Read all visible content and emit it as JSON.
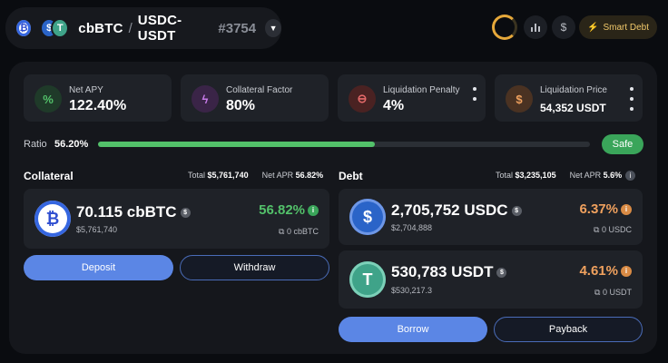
{
  "header": {
    "tokens": [
      {
        "icon": "bitcoin-icon",
        "glyph": "₿"
      },
      {
        "icon": "usdc-icon",
        "glyph": "$"
      },
      {
        "icon": "usdt-icon",
        "glyph": "T"
      }
    ],
    "asset": "cbBTC",
    "slash": "/",
    "pair": "USDC-USDT",
    "id": "#3754",
    "dropdown_glyph": "▼"
  },
  "controls": {
    "chart_glyph": "📊",
    "dollar_glyph": "$",
    "smart_debt_glyph": "⚡",
    "smart_debt_label": "Smart Debt"
  },
  "stats": [
    {
      "label": "Net APY",
      "value": "122.40%",
      "icon": "percent-icon",
      "glyph": "%",
      "color": "#3fae5e"
    },
    {
      "label": "Collateral Factor",
      "value": "80%",
      "icon": "lightning-icon",
      "glyph": "ϟ",
      "color": "#b45ae0"
    },
    {
      "label": "Liquidation Penalty",
      "value": "4%",
      "icon": "minus-circle-icon",
      "glyph": "⊖",
      "color": "#e25555"
    },
    {
      "label": "Liquidation Price",
      "value": "54,352 USDT",
      "icon": "dollar-icon",
      "glyph": "$",
      "color": "#e08a3c"
    }
  ],
  "ratio": {
    "label": "Ratio",
    "value": "56.20%",
    "fill_fraction": 0.562,
    "status": "Safe"
  },
  "collateral": {
    "title": "Collateral",
    "total_label": "Total",
    "total": "$5,761,740",
    "apr_label": "Net APR",
    "apr": "56.82%",
    "item": {
      "amount": "70.115 cbBTC",
      "usd": "$5,761,740",
      "rate": "56.82%",
      "balance": "0 cbBTC",
      "icon": "bitcoin-icon",
      "glyph": "₿",
      "rate_color": "#53c16a"
    },
    "buttons": {
      "deposit": "Deposit",
      "withdraw": "Withdraw"
    }
  },
  "debt": {
    "title": "Debt",
    "total_label": "Total",
    "total": "$3,235,105",
    "apr_label": "Net APR",
    "apr": "5.6%",
    "items": [
      {
        "amount": "2,705,752 USDC",
        "usd": "$2,704,888",
        "rate": "6.37%",
        "balance": "0 USDC",
        "icon": "usdc-icon",
        "glyph": "$",
        "rate_color": "#f0a15e"
      },
      {
        "amount": "530,783 USDT",
        "usd": "$530,217.3",
        "rate": "4.61%",
        "balance": "0 USDT",
        "icon": "usdt-icon",
        "glyph": "T",
        "rate_color": "#f0a15e"
      }
    ],
    "buttons": {
      "borrow": "Borrow",
      "payback": "Payback"
    }
  }
}
